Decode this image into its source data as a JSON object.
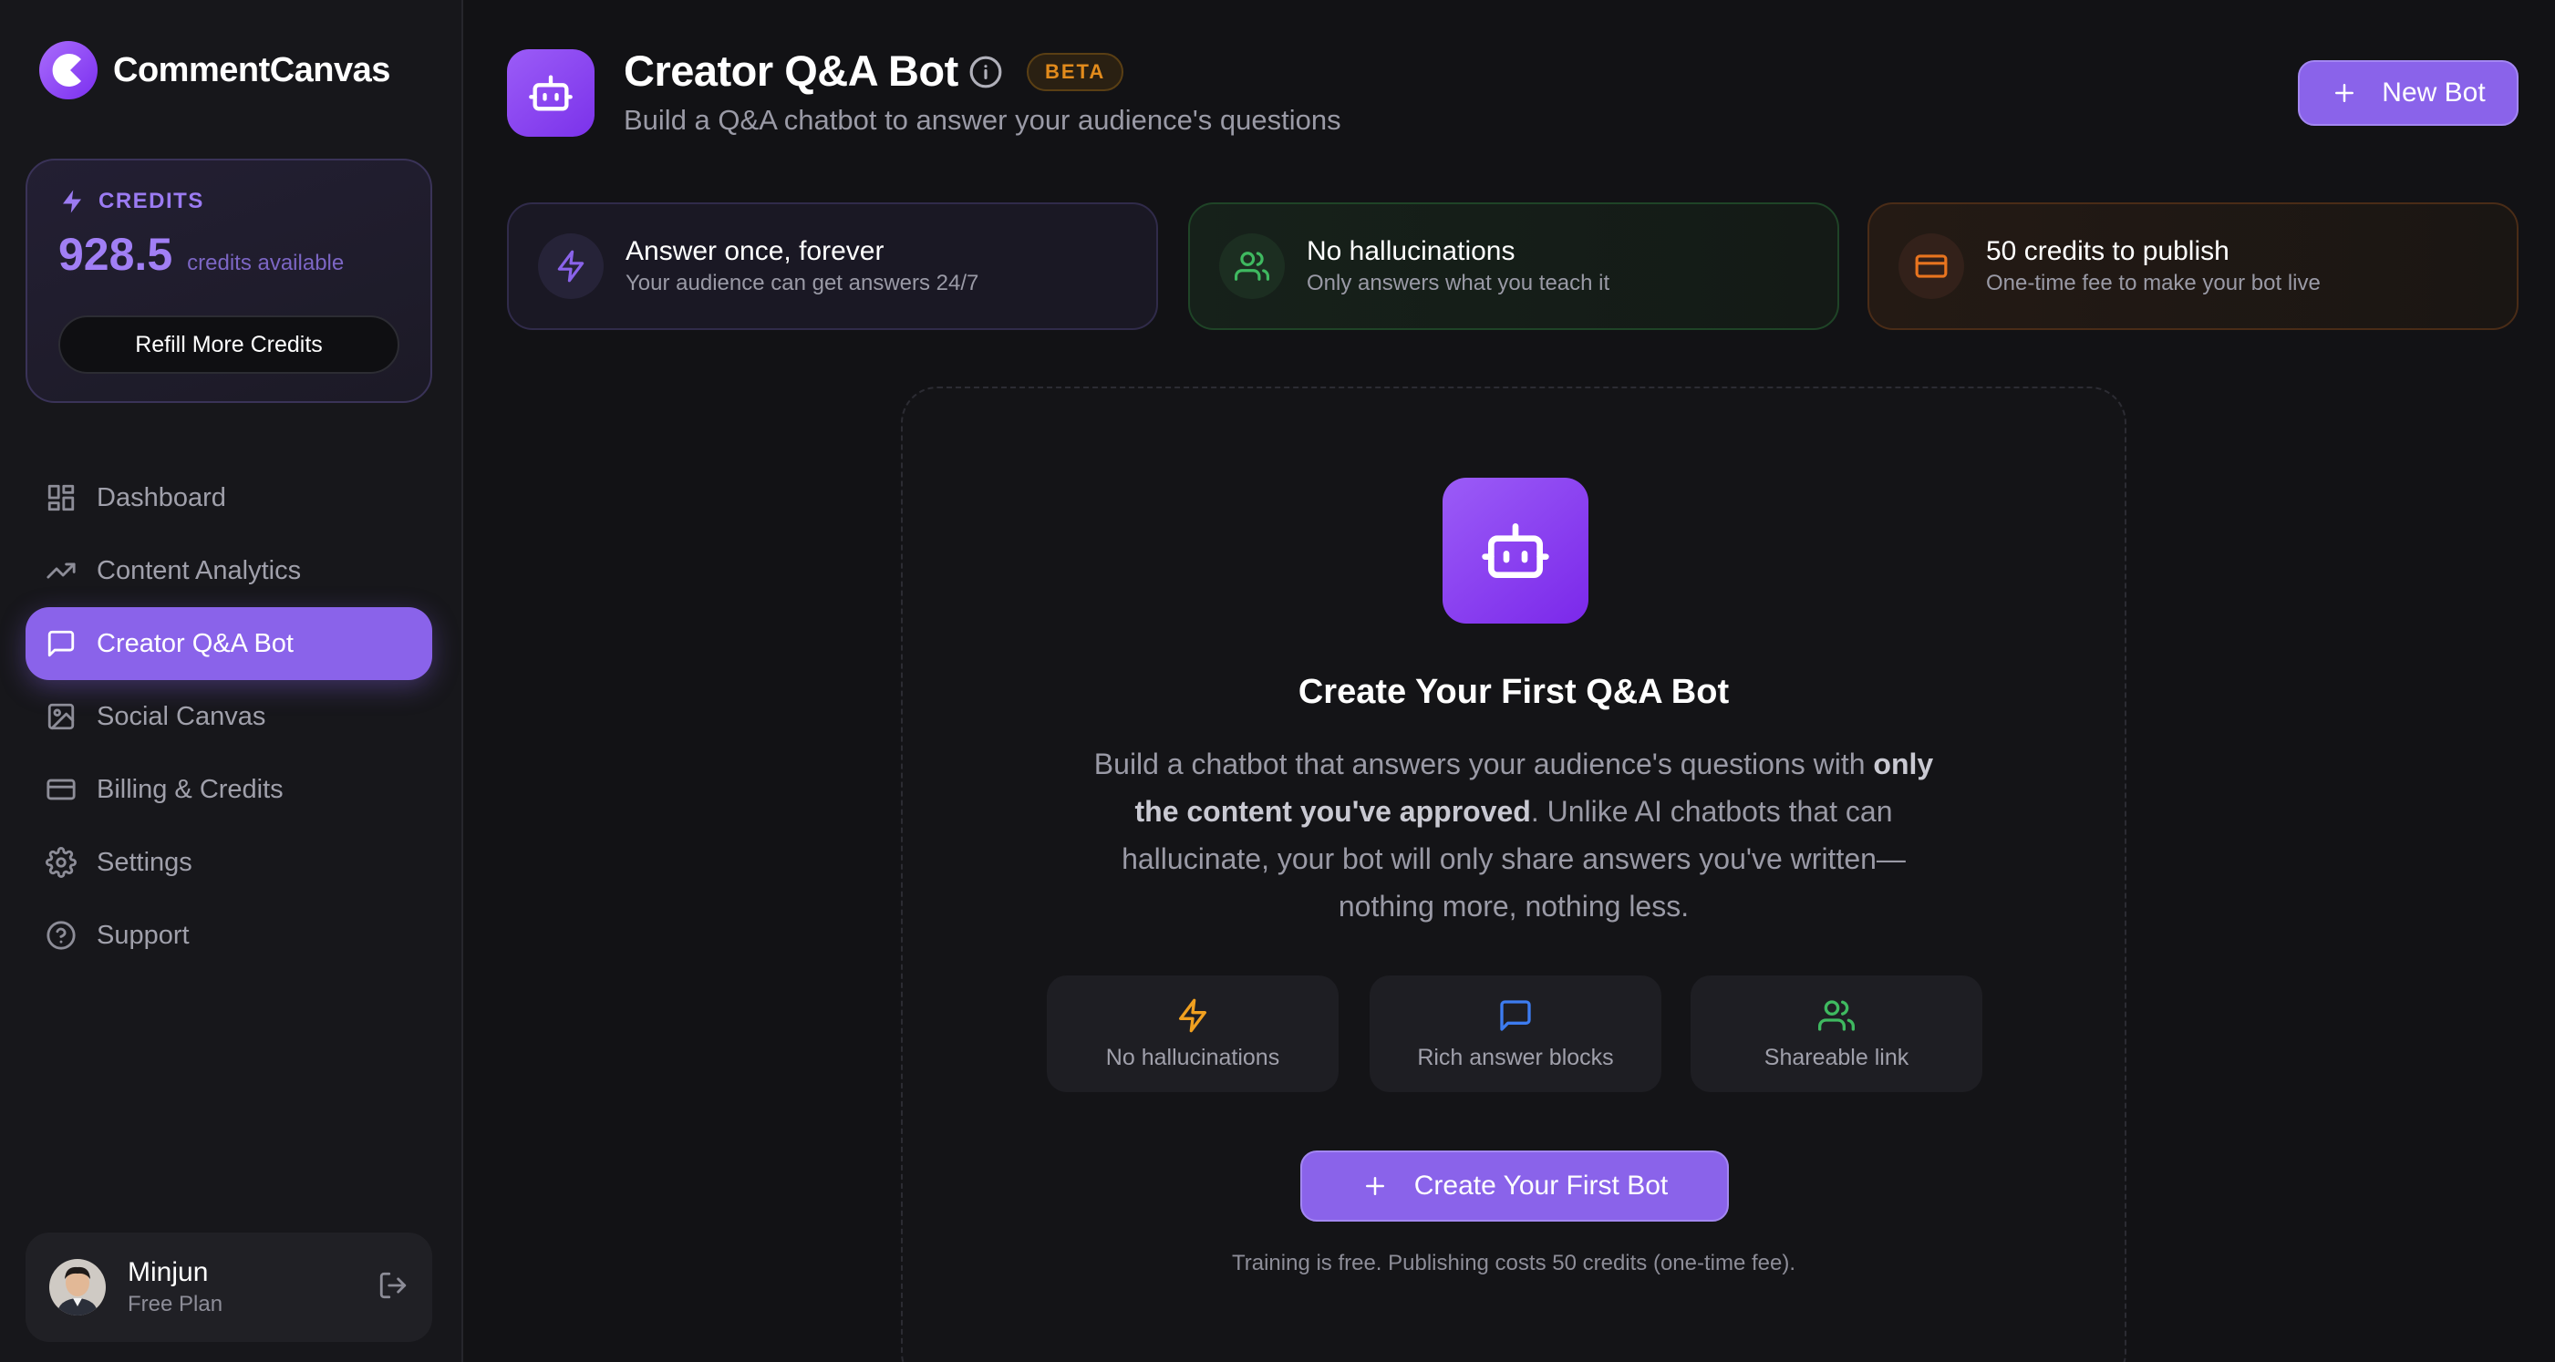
{
  "brand": {
    "name": "CommentCanvas",
    "accent": "#8a63ea"
  },
  "credits": {
    "heading": "CREDITS",
    "value": "928.5",
    "unit_label": "credits available",
    "refill_label": "Refill More Credits"
  },
  "nav": {
    "items": [
      {
        "label": "Dashboard",
        "icon": "dashboard-icon"
      },
      {
        "label": "Content Analytics",
        "icon": "trending-up-icon"
      },
      {
        "label": "Creator Q&A Bot",
        "icon": "message-square-icon",
        "active": true
      },
      {
        "label": "Social Canvas",
        "icon": "image-icon"
      },
      {
        "label": "Billing & Credits",
        "icon": "credit-card-icon"
      },
      {
        "label": "Settings",
        "icon": "gear-icon"
      },
      {
        "label": "Support",
        "icon": "help-circle-icon"
      }
    ]
  },
  "user": {
    "name": "Minjun",
    "plan": "Free Plan"
  },
  "header": {
    "title": "Creator Q&A Bot",
    "badge": "BETA",
    "subtitle": "Build a Q&A chatbot to answer your audience's questions",
    "new_bot_label": "New Bot"
  },
  "features": [
    {
      "title": "Answer once, forever",
      "subtitle": "Your audience can get answers 24/7",
      "icon": "zap-icon",
      "color": "#8a63ea"
    },
    {
      "title": "No hallucinations",
      "subtitle": "Only answers what you teach it",
      "icon": "users-icon",
      "color": "#3fb960"
    },
    {
      "title": "50 credits to publish",
      "subtitle": "One-time fee to make your bot live",
      "icon": "credit-card-icon",
      "color": "#e8741f"
    }
  ],
  "empty_state": {
    "title": "Create Your First Q&A Bot",
    "desc_pre": "Build a chatbot that answers your audience's questions with ",
    "desc_bold": "only the content you've approved",
    "desc_post": ". Unlike AI chatbots that can hallucinate, your bot will only share answers you've written—nothing more, nothing less.",
    "highlights": [
      {
        "label": "No hallucinations",
        "icon": "zap-icon",
        "color": "#f0a020"
      },
      {
        "label": "Rich answer blocks",
        "icon": "message-square-icon",
        "color": "#3d7cf0"
      },
      {
        "label": "Shareable link",
        "icon": "users-icon",
        "color": "#3fb960"
      }
    ],
    "cta_label": "Create Your First Bot",
    "footnote": "Training is free. Publishing costs 50 credits (one-time fee)."
  }
}
